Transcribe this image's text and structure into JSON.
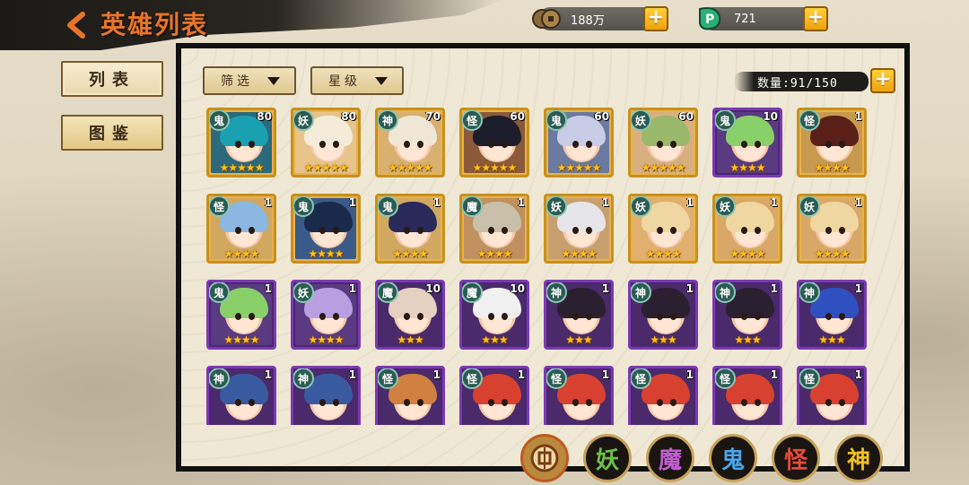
{
  "header": {
    "title": "英雄列表",
    "back_icon": "back-arrow-icon"
  },
  "resources": [
    {
      "icon": "coin-icon",
      "value": "188万"
    },
    {
      "icon": "jade-icon",
      "value": "721"
    }
  ],
  "sidebar": {
    "tabs": [
      {
        "label": "列表",
        "active": true
      },
      {
        "label": "图鉴",
        "active": false
      }
    ]
  },
  "filters": {
    "filter_label": "筛选",
    "star_label": "星级"
  },
  "capacity": {
    "text": "数量:91/150"
  },
  "race_filters": [
    {
      "label": "",
      "icon": "all-coin-icon",
      "color": "#c05a20"
    },
    {
      "label": "妖",
      "color": "#6cc04a"
    },
    {
      "label": "魔",
      "color": "#c060d0"
    },
    {
      "label": "鬼",
      "color": "#4aa6e8"
    },
    {
      "label": "怪",
      "color": "#e84a3a"
    },
    {
      "label": "神",
      "color": "#f0c020"
    }
  ],
  "heroes": [
    {
      "race": "鬼",
      "level": "80",
      "stars": "★★★★★",
      "frame": "gold",
      "bg": "#2a6a7a",
      "hair": "#1aa0b0"
    },
    {
      "race": "妖",
      "level": "80",
      "stars": "★★★★★",
      "frame": "gold",
      "bg": "#e6c48a",
      "hair": "#f4ecd8"
    },
    {
      "race": "神",
      "level": "70",
      "stars": "★★★★★",
      "frame": "gold",
      "bg": "#d8b070",
      "hair": "#efe6d6"
    },
    {
      "race": "怪",
      "level": "60",
      "stars": "★★★★★",
      "frame": "gold",
      "bg": "#8a5a3a",
      "hair": "#1c1c2a"
    },
    {
      "race": "鬼",
      "level": "60",
      "stars": "★★★★★",
      "frame": "gold",
      "bg": "#6a7aa0",
      "hair": "#c8cce6"
    },
    {
      "race": "妖",
      "level": "60",
      "stars": "★★★★★",
      "frame": "gold",
      "bg": "#d8b080",
      "hair": "#9ab86a"
    },
    {
      "race": "鬼",
      "level": "10",
      "stars": "★★★★",
      "frame": "purple",
      "bg": "#5a3a80",
      "hair": "#8ad06a"
    },
    {
      "race": "怪",
      "level": "1",
      "stars": "★★★★",
      "frame": "gold",
      "bg": "#c89a50",
      "hair": "#5a2018"
    },
    {
      "race": "怪",
      "level": "1",
      "stars": "★★★★",
      "frame": "gold",
      "bg": "#d0a860",
      "hair": "#8ab8e0"
    },
    {
      "race": "鬼",
      "level": "1",
      "stars": "★★★★",
      "frame": "gold",
      "bg": "#3a5a8a",
      "hair": "#1a2a4a"
    },
    {
      "race": "鬼",
      "level": "1",
      "stars": "★★★★",
      "frame": "gold",
      "bg": "#d0a860",
      "hair": "#2a2a5a"
    },
    {
      "race": "魔",
      "level": "1",
      "stars": "★★★★",
      "frame": "gold",
      "bg": "#c09060",
      "hair": "#c8c0a8"
    },
    {
      "race": "妖",
      "level": "1",
      "stars": "★★★★",
      "frame": "gold",
      "bg": "#c8a070",
      "hair": "#e6e6ea"
    },
    {
      "race": "妖",
      "level": "1",
      "stars": "★★★★",
      "frame": "gold",
      "bg": "#e0b070",
      "hair": "#f0d6a0"
    },
    {
      "race": "妖",
      "level": "1",
      "stars": "★★★★",
      "frame": "gold",
      "bg": "#d8a868",
      "hair": "#f0d6a0"
    },
    {
      "race": "妖",
      "level": "1",
      "stars": "★★★★",
      "frame": "gold",
      "bg": "#d8a868",
      "hair": "#f0d6a0"
    },
    {
      "race": "鬼",
      "level": "1",
      "stars": "★★★★",
      "frame": "purple",
      "bg": "#5a3a80",
      "hair": "#8ad06a"
    },
    {
      "race": "妖",
      "level": "1",
      "stars": "★★★★",
      "frame": "purple",
      "bg": "#5a3a80",
      "hair": "#b8a0e0"
    },
    {
      "race": "魔",
      "level": "10",
      "stars": "★★★",
      "frame": "purple",
      "bg": "#4a2a6a",
      "hair": "#e6d0c0"
    },
    {
      "race": "魔",
      "level": "10",
      "stars": "★★★",
      "frame": "purple",
      "bg": "#4a2a6a",
      "hair": "#f0f0f0"
    },
    {
      "race": "神",
      "level": "1",
      "stars": "★★★",
      "frame": "purple",
      "bg": "#4a2a6a",
      "hair": "#2a2030"
    },
    {
      "race": "神",
      "level": "1",
      "stars": "★★★",
      "frame": "purple",
      "bg": "#4a2a6a",
      "hair": "#2a2030"
    },
    {
      "race": "神",
      "level": "1",
      "stars": "★★★",
      "frame": "purple",
      "bg": "#4a2a6a",
      "hair": "#2a2030"
    },
    {
      "race": "神",
      "level": "1",
      "stars": "★★★",
      "frame": "purple",
      "bg": "#4a2a6a",
      "hair": "#3050c0"
    },
    {
      "race": "神",
      "level": "1",
      "stars": "",
      "frame": "purple",
      "bg": "#4a2a6a",
      "hair": "#3a5aa0"
    },
    {
      "race": "神",
      "level": "1",
      "stars": "",
      "frame": "purple",
      "bg": "#4a2a6a",
      "hair": "#3a5aa0"
    },
    {
      "race": "怪",
      "level": "1",
      "stars": "",
      "frame": "purple",
      "bg": "#4a2a6a",
      "hair": "#d08040"
    },
    {
      "race": "怪",
      "level": "1",
      "stars": "",
      "frame": "purple",
      "bg": "#4a2a6a",
      "hair": "#d84030"
    },
    {
      "race": "怪",
      "level": "1",
      "stars": "",
      "frame": "purple",
      "bg": "#4a2a6a",
      "hair": "#d84030"
    },
    {
      "race": "怪",
      "level": "1",
      "stars": "",
      "frame": "purple",
      "bg": "#4a2a6a",
      "hair": "#d84030"
    },
    {
      "race": "怪",
      "level": "1",
      "stars": "",
      "frame": "purple",
      "bg": "#4a2a6a",
      "hair": "#d84030"
    },
    {
      "race": "怪",
      "level": "1",
      "stars": "",
      "frame": "purple",
      "bg": "#4a2a6a",
      "hair": "#d84030"
    }
  ]
}
